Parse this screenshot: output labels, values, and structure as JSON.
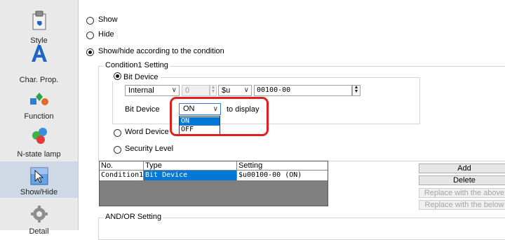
{
  "sidebar": {
    "items": [
      {
        "label": "Style",
        "icon": "style-icon"
      },
      {
        "label": "Char. Prop.",
        "icon": "char-prop-icon"
      },
      {
        "label": "Function",
        "icon": "function-icon"
      },
      {
        "label": "N-state lamp",
        "icon": "n-state-lamp-icon"
      },
      {
        "label": "Show/Hide",
        "icon": "show-hide-icon",
        "selected": true
      },
      {
        "label": "Detail",
        "icon": "detail-icon"
      }
    ]
  },
  "display_mode": {
    "options": [
      "Show",
      "Hide",
      "Show/hide according to the condition"
    ],
    "selected": "Show/hide according to the condition"
  },
  "condition": {
    "group_title": "Condition1 Setting",
    "bit_device_label": "Bit Device",
    "device_type": "Internal",
    "station_number": "0",
    "device_prefix": "$u",
    "device_address": "00100-00",
    "bit_device_row_label": "Bit Device",
    "display_state": "ON",
    "to_display": "to display",
    "dropdown_options": [
      "ON",
      "OFF"
    ],
    "word_device_label": "Word Device",
    "security_level_label": "Security Level"
  },
  "table": {
    "headers": [
      "No.",
      "Type",
      "Setting"
    ],
    "rows": [
      {
        "no": "Condition1",
        "type": "Bit Device",
        "setting": "$u00100-00 (ON)"
      }
    ]
  },
  "buttons": {
    "add": "Add",
    "delete": "Delete",
    "replace_above": "Replace with the above",
    "replace_below": "Replace with the below"
  },
  "and_or_label": "AND/OR Setting",
  "colors": {
    "selection": "#0078d7",
    "highlight": "#e02020",
    "table_bg": "#808080"
  }
}
